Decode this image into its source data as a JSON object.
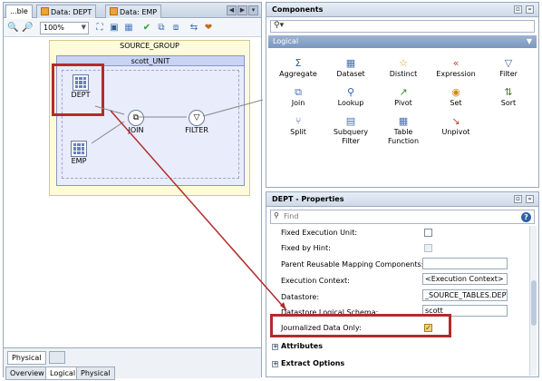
{
  "editor": {
    "tabs": [
      {
        "label": "...ble"
      },
      {
        "label": "Data: DEPT"
      },
      {
        "label": "Data: EMP"
      }
    ],
    "zoom": "100%",
    "source_group": "SOURCE_GROUP",
    "unit": "scott_UNIT",
    "nodes": {
      "dept": "DEPT",
      "emp": "EMP",
      "join": "JOIN",
      "filter": "FILTER"
    },
    "bottom_tab": "Physical",
    "view_tabs": [
      "Overview",
      "Logical",
      "Physical"
    ]
  },
  "components": {
    "title": "Components",
    "category": "Logical",
    "items": [
      {
        "label": "Aggregate",
        "icon": "sigma-icon"
      },
      {
        "label": "Dataset",
        "icon": "dataset-icon"
      },
      {
        "label": "Distinct",
        "icon": "star-icon"
      },
      {
        "label": "Expression",
        "icon": "expression-icon"
      },
      {
        "label": "Filter",
        "icon": "funnel-icon"
      },
      {
        "label": "Join",
        "icon": "join-icon"
      },
      {
        "label": "Lookup",
        "icon": "magnifier-icon"
      },
      {
        "label": "Pivot",
        "icon": "pivot-icon"
      },
      {
        "label": "Set",
        "icon": "set-icon"
      },
      {
        "label": "Sort",
        "icon": "sort-icon"
      },
      {
        "label": "Split",
        "icon": "split-icon"
      },
      {
        "label": "Subquery\nFilter",
        "icon": "subquery-icon"
      },
      {
        "label": "Table\nFunction",
        "icon": "table-function-icon"
      },
      {
        "label": "Unpivot",
        "icon": "unpivot-icon"
      }
    ]
  },
  "properties": {
    "title": "DEPT - Properties",
    "search_placeholder": "Find",
    "rows": {
      "fixed_exec": "Fixed Execution Unit:",
      "fixed_hint": "Fixed by Hint:",
      "parent_reusable": "Parent Reusable Mapping Components:",
      "exec_context": "Execution Context:",
      "exec_context_value": "<Execution Context>",
      "datastore": "Datastore:",
      "datastore_value": "_SOURCE_TABLES.DEPT",
      "logical_schema": "Datastore Logical Schema:",
      "logical_schema_value": "scott",
      "journalized": "Journalized Data Only:"
    },
    "sections": [
      "Attributes",
      "Extract Options"
    ]
  }
}
